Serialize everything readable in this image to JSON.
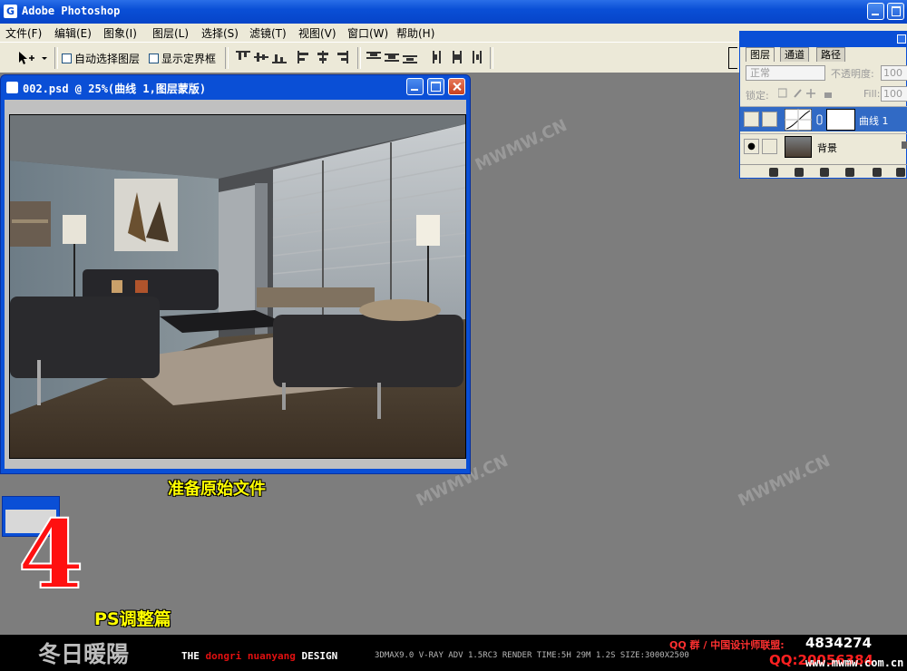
{
  "app": {
    "title": "Adobe Photoshop"
  },
  "menu": [
    "文件(F)",
    "编辑(E)",
    "图象(I)",
    "图层(L)",
    "选择(S)",
    "滤镜(T)",
    "视图(V)",
    "窗口(W)",
    "帮助(H)"
  ],
  "options": {
    "auto_select": "自动选择图层",
    "show_bounds": "显示定界框"
  },
  "document": {
    "title": "002.psd @ 25%(曲线 1,图层蒙版)"
  },
  "caption": "准备原始文件",
  "step": {
    "number": "4",
    "label": "PS调整篇"
  },
  "banner": {
    "cn_title": "冬日暖陽",
    "design_prefix": "THE ",
    "design_red": "dongri nuanyang",
    "design_suffix": " DESIGN",
    "specs": "3DMAX9.0  V-RAY ADV 1.5RC3   RENDER TIME:5H 29M 1.2S  SIZE:3000X2500",
    "qq_label": "QQ 群 / 中国设计师联盟:",
    "qq1": "4834274",
    "qq2": "QQ:20056384",
    "site": "www.mwmw.com.cn"
  },
  "layers_panel": {
    "tabs": [
      "图层",
      "通道",
      "路径"
    ],
    "blend_mode": "正常",
    "opacity_label": "不透明度:",
    "opacity_value": "100",
    "lock_label": "锁定:",
    "fill_label": "Fill:",
    "fill_value": "100",
    "layers": [
      {
        "name": "曲线 1",
        "selected": true
      },
      {
        "name": "背景",
        "selected": false
      }
    ]
  },
  "watermark": "MWMW.CN"
}
